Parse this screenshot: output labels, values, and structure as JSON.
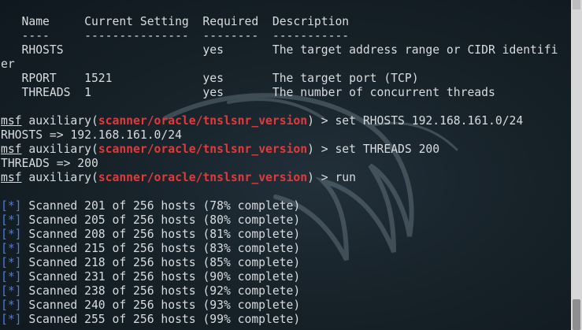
{
  "table": {
    "header": "   Name     Current Setting  Required  Description",
    "rule": "   ----     ---------------  --------  -----------",
    "rows": [
      "   RHOSTS                    yes       The target address range or CIDR identifi",
      "er",
      "   RPORT    1521             yes       The target port (TCP)",
      "   THREADS  1                yes       The number of concurrent threads"
    ]
  },
  "prompt": {
    "msf": "msf",
    "auxiliary_open": " auxiliary(",
    "module": "scanner/oracle/tnslsnr_version",
    "auxiliary_close": ") > "
  },
  "commands": [
    {
      "cmd": "set RHOSTS 192.168.161.0/24",
      "output": "RHOSTS => 192.168.161.0/24"
    },
    {
      "cmd": "set THREADS 200",
      "output": "THREADS => 200"
    },
    {
      "cmd": "run"
    }
  ],
  "scan": {
    "marker": "[*]",
    "lines": [
      " Scanned 201 of 256 hosts (78% complete)",
      " Scanned 205 of 256 hosts (80% complete)",
      " Scanned 208 of 256 hosts (81% complete)",
      " Scanned 215 of 256 hosts (83% complete)",
      " Scanned 218 of 256 hosts (85% complete)",
      " Scanned 231 of 256 hosts (90% complete)",
      " Scanned 238 of 256 hosts (92% complete)",
      " Scanned 240 of 256 hosts (93% complete)",
      " Scanned 255 of 256 hosts (99% complete)"
    ]
  },
  "colors": {
    "background": "#0f1a22",
    "text": "#d8dcdf",
    "module": "#e23a3a",
    "status": "#4a7de0"
  },
  "icons": {
    "watermark": "kali-dragon-icon"
  }
}
